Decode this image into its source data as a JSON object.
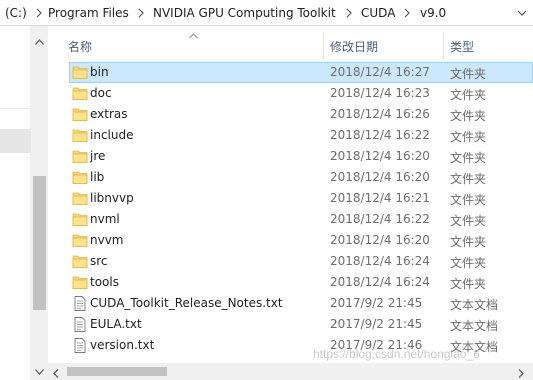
{
  "breadcrumb": {
    "drive": "(C:)",
    "segments": [
      "Program Files",
      "NVIDIA GPU Computing Toolkit",
      "CUDA",
      "v9.0"
    ]
  },
  "columns": {
    "name": "名称",
    "date_modified": "修改日期",
    "type": "类型"
  },
  "files": [
    {
      "name": "bin",
      "date": "2018/12/4 16:27",
      "type": "文件夹",
      "icon": "folder-icon",
      "selected": true
    },
    {
      "name": "doc",
      "date": "2018/12/4 16:23",
      "type": "文件夹",
      "icon": "folder-icon"
    },
    {
      "name": "extras",
      "date": "2018/12/4 16:26",
      "type": "文件夹",
      "icon": "folder-icon"
    },
    {
      "name": "include",
      "date": "2018/12/4 16:22",
      "type": "文件夹",
      "icon": "folder-icon"
    },
    {
      "name": "jre",
      "date": "2018/12/4 16:20",
      "type": "文件夹",
      "icon": "folder-icon"
    },
    {
      "name": "lib",
      "date": "2018/12/4 16:20",
      "type": "文件夹",
      "icon": "folder-icon"
    },
    {
      "name": "libnvvp",
      "date": "2018/12/4 16:21",
      "type": "文件夹",
      "icon": "folder-icon"
    },
    {
      "name": "nvml",
      "date": "2018/12/4 16:22",
      "type": "文件夹",
      "icon": "folder-icon"
    },
    {
      "name": "nvvm",
      "date": "2018/12/4 16:20",
      "type": "文件夹",
      "icon": "folder-icon"
    },
    {
      "name": "src",
      "date": "2018/12/4 16:24",
      "type": "文件夹",
      "icon": "folder-icon"
    },
    {
      "name": "tools",
      "date": "2018/12/4 16:24",
      "type": "文件夹",
      "icon": "folder-icon"
    },
    {
      "name": "CUDA_Toolkit_Release_Notes.txt",
      "date": "2017/9/2 21:45",
      "type": "文本文档",
      "icon": "text-file-icon"
    },
    {
      "name": "EULA.txt",
      "date": "2017/9/2 21:45",
      "type": "文本文档",
      "icon": "text-file-icon"
    },
    {
      "name": "version.txt",
      "date": "2017/9/2 21:46",
      "type": "文本文档",
      "icon": "text-file-icon"
    }
  ],
  "watermark": "https://blog.csdn.net/hongiao_6",
  "colors": {
    "selection_fill": "#cce8ff",
    "selection_border": "#99d1ff",
    "folder": "#f8d775",
    "header_text": "#4c607a"
  }
}
